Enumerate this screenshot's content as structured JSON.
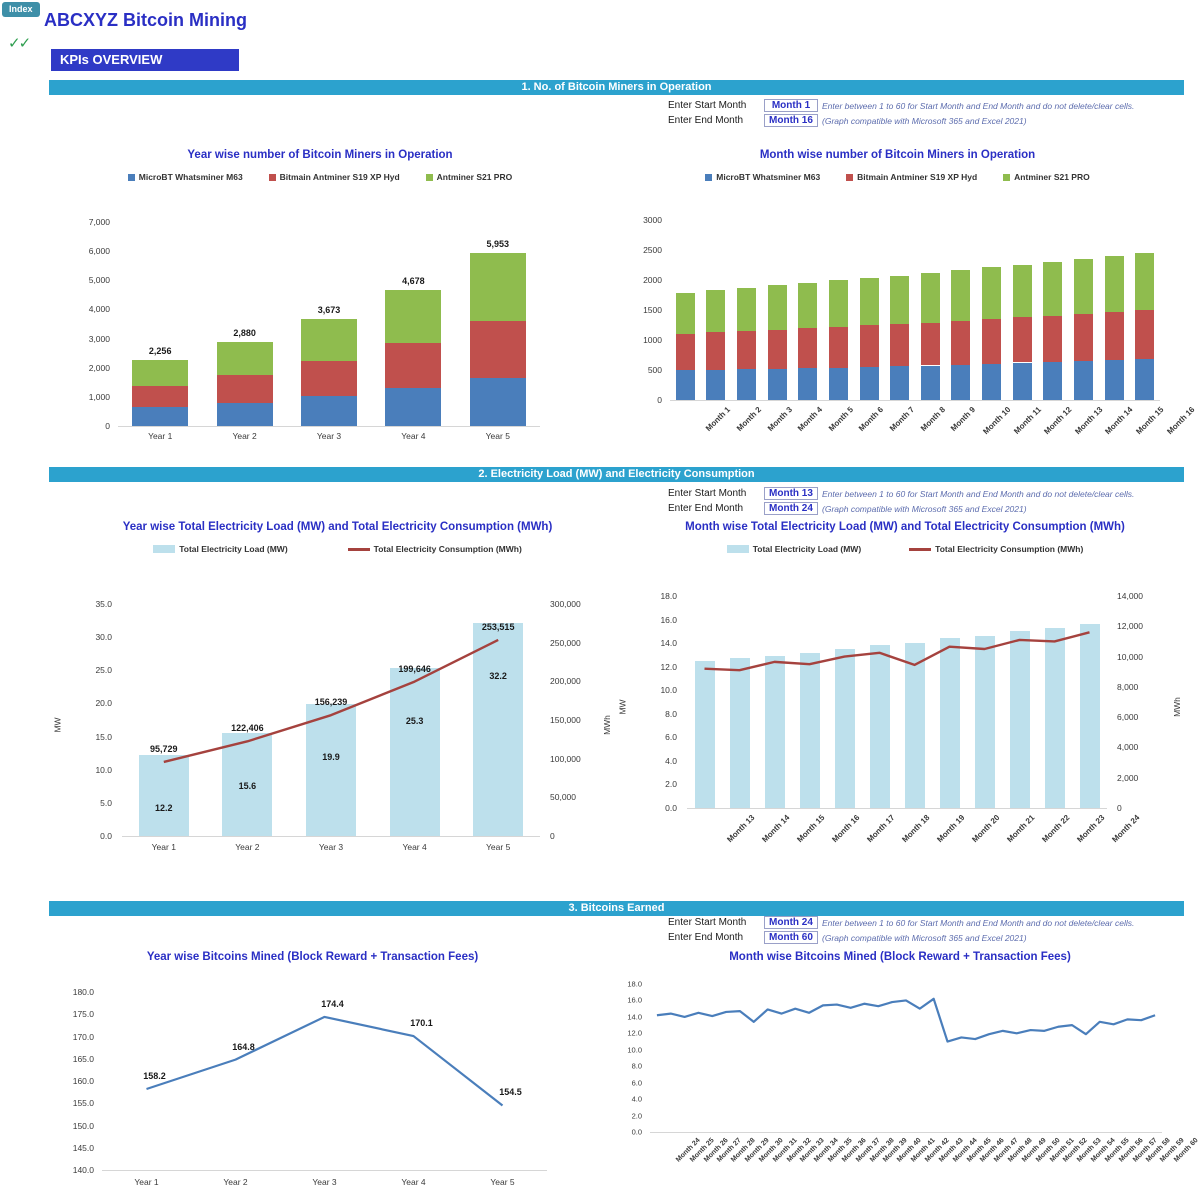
{
  "header": {
    "index_button": "Index",
    "checkmarks": "✓✓",
    "app_title": "ABCXYZ Bitcoin Mining",
    "kpi_tag": "KPIs OVERVIEW",
    "accent_teal": "#2CA2CE",
    "accent_blue": "#2F3AC6",
    "title_blue": "#2A2FC4"
  },
  "sections": [
    {
      "id": "sec1",
      "bar_title": "1. No. of Bitcoin Miners in Operation",
      "inputs": {
        "start_label": "Enter Start Month",
        "start_value": "Month 1",
        "end_label": "Enter End Month",
        "end_value": "Month 16",
        "note1": "Enter between 1 to 60 for Start Month and End Month and do not delete/clear cells.",
        "note2": "(Graph compatible with Microsoft 365 and Excel 2021)"
      }
    },
    {
      "id": "sec2",
      "bar_title": "2. Electricity Load (MW) and Electricity Consumption",
      "inputs": {
        "start_label": "Enter Start Month",
        "start_value": "Month 13",
        "end_label": "Enter End Month",
        "end_value": "Month 24",
        "note1": "Enter between 1 to 60 for Start Month and End Month and do not delete/clear cells.",
        "note2": "(Graph compatible with Microsoft 365 and Excel 2021)"
      }
    },
    {
      "id": "sec3",
      "bar_title": "3. Bitcoins Earned",
      "inputs": {
        "start_label": "Enter Start Month",
        "start_value": "Month 24",
        "end_label": "Enter End Month",
        "end_value": "Month 60",
        "note1": "Enter between 1 to 60 for Start Month and End Month and do not delete/clear cells.",
        "note2": "(Graph compatible with Microsoft 365 and Excel 2021)"
      }
    }
  ],
  "chart_data": [
    {
      "id": "year_miners",
      "type": "bar",
      "stacked": true,
      "title": "Year wise number of Bitcoin Miners in Operation",
      "xlabel": "",
      "ylabel": "",
      "ylim": [
        0,
        7000
      ],
      "yticks": [
        0,
        1000,
        2000,
        3000,
        4000,
        5000,
        6000,
        7000
      ],
      "ytick_labels": [
        "0",
        "1,000",
        "2,000",
        "3,000",
        "4,000",
        "5,000",
        "6,000",
        "7,000"
      ],
      "grid": false,
      "legend_position": "top",
      "categories": [
        "Year 1",
        "Year 2",
        "Year 3",
        "Year 4",
        "Year 5"
      ],
      "series": [
        {
          "name": "MicroBT Whatsminer M63",
          "color": "#4A7EBB",
          "values": [
            640,
            800,
            1020,
            1300,
            1630
          ]
        },
        {
          "name": "Bitmain Antminer S19 XP Hyd",
          "color": "#C0504D",
          "values": [
            740,
            950,
            1210,
            1540,
            1960
          ]
        },
        {
          "name": "Antminer S21 PRO",
          "color": "#8FBC4E",
          "values": [
            876,
            1130,
            1443,
            1838,
            2363
          ]
        }
      ],
      "totals": [
        2256,
        2880,
        3673,
        4678,
        5953
      ],
      "total_labels": [
        "2,256",
        "2,880",
        "3,673",
        "4,678",
        "5,953"
      ]
    },
    {
      "id": "month_miners",
      "type": "bar",
      "stacked": true,
      "title": "Month wise number of Bitcoin Miners in Operation",
      "xlabel": "",
      "ylabel": "",
      "ylim": [
        0,
        3000
      ],
      "yticks": [
        0,
        500,
        1000,
        1500,
        2000,
        2500,
        3000
      ],
      "ytick_labels": [
        "0",
        "500",
        "1000",
        "1500",
        "2000",
        "2500",
        "3000"
      ],
      "grid": false,
      "legend_position": "top",
      "categories": [
        "Month 1",
        "Month 2",
        "Month 3",
        "Month 4",
        "Month 5",
        "Month 6",
        "Month 7",
        "Month 8",
        "Month 9",
        "Month 10",
        "Month 11",
        "Month 12",
        "Month 13",
        "Month 14",
        "Month 15",
        "Month 16"
      ],
      "series": [
        {
          "name": "MicroBT Whatsminer M63",
          "color": "#4A7EBB",
          "values": [
            495,
            500,
            510,
            515,
            530,
            540,
            550,
            570,
            575,
            585,
            600,
            625,
            635,
            650,
            660,
            680
          ]
        },
        {
          "name": "Bitmain Antminer S19 XP Hyd",
          "color": "#C0504D",
          "values": [
            605,
            630,
            640,
            655,
            670,
            680,
            695,
            700,
            715,
            735,
            750,
            755,
            770,
            785,
            805,
            815
          ]
        },
        {
          "name": "Antminer S21 PRO",
          "color": "#8FBC4E",
          "values": [
            690,
            700,
            720,
            740,
            755,
            775,
            790,
            805,
            830,
            840,
            870,
            870,
            890,
            915,
            930,
            950
          ]
        }
      ],
      "totals": [
        1790,
        1830,
        1870,
        1910,
        1955,
        1995,
        2035,
        2075,
        2120,
        2160,
        2220,
        2250,
        2295,
        2350,
        2395,
        2445
      ]
    },
    {
      "id": "year_electricity",
      "type": "bar_line_combo",
      "title": "Year wise Total Electricity Load (MW) and Total Electricity Consumption (MWh)",
      "xlabel": "",
      "ylabel": "MW",
      "y2label": "MWh",
      "ylim": [
        0,
        35
      ],
      "yticks": [
        0,
        5,
        10,
        15,
        20,
        25,
        30,
        35
      ],
      "ytick_labels": [
        "0.0",
        "5.0",
        "10.0",
        "15.0",
        "20.0",
        "25.0",
        "30.0",
        "35.0"
      ],
      "y2lim": [
        0,
        300000
      ],
      "y2ticks": [
        0,
        50000,
        100000,
        150000,
        200000,
        250000,
        300000
      ],
      "y2tick_labels": [
        "0",
        "50,000",
        "100,000",
        "150,000",
        "200,000",
        "250,000",
        "300,000"
      ],
      "grid": false,
      "legend_position": "top",
      "categories": [
        "Year 1",
        "Year 2",
        "Year 3",
        "Year 4",
        "Year 5"
      ],
      "series": [
        {
          "name": "Total Electricity Load (MW)",
          "type": "bar",
          "color": "#BDE0EC",
          "axis": "left",
          "values": [
            12.2,
            15.6,
            19.9,
            25.3,
            32.2
          ],
          "labels": [
            "12.2",
            "15.6",
            "19.9",
            "25.3",
            "32.2"
          ]
        },
        {
          "name": "Total Electricity Consumption (MWh)",
          "type": "line",
          "color": "#A5423E",
          "axis": "right",
          "values": [
            95729,
            122406,
            156239,
            199646,
            253515
          ],
          "labels": [
            "95,729",
            "122,406",
            "156,239",
            "199,646",
            "253,515"
          ]
        }
      ]
    },
    {
      "id": "month_electricity",
      "type": "bar_line_combo",
      "title": "Month wise Total Electricity Load (MW) and Total Electricity Consumption (MWh)",
      "xlabel": "",
      "ylabel": "MW",
      "y2label": "MWh",
      "ylim": [
        0,
        18
      ],
      "yticks": [
        0,
        2,
        4,
        6,
        8,
        10,
        12,
        14,
        16,
        18
      ],
      "ytick_labels": [
        "0.0",
        "2.0",
        "4.0",
        "6.0",
        "8.0",
        "10.0",
        "12.0",
        "14.0",
        "16.0",
        "18.0"
      ],
      "y2lim": [
        0,
        14000
      ],
      "y2ticks": [
        0,
        2000,
        4000,
        6000,
        8000,
        10000,
        12000,
        14000
      ],
      "y2tick_labels": [
        "0",
        "2,000",
        "4,000",
        "6,000",
        "8,000",
        "10,000",
        "12,000",
        "14,000"
      ],
      "grid": false,
      "legend_position": "top",
      "categories": [
        "Month 13",
        "Month 14",
        "Month 15",
        "Month 16",
        "Month 17",
        "Month 18",
        "Month 19",
        "Month 20",
        "Month 21",
        "Month 22",
        "Month 23",
        "Month 24"
      ],
      "series": [
        {
          "name": "Total Electricity Load (MW)",
          "type": "bar",
          "color": "#BDE0EC",
          "axis": "left",
          "values": [
            12.5,
            12.7,
            12.9,
            13.2,
            13.5,
            13.8,
            14.0,
            14.4,
            14.6,
            15.0,
            15.3,
            15.6
          ]
        },
        {
          "name": "Total Electricity Consumption (MWh)",
          "type": "line",
          "color": "#A5423E",
          "axis": "right",
          "values": [
            9200,
            9100,
            9650,
            9500,
            10000,
            10250,
            9450,
            10650,
            10500,
            11100,
            11000,
            11600
          ]
        }
      ]
    },
    {
      "id": "year_bitcoins",
      "type": "line",
      "title": "Year wise Bitcoins Mined (Block Reward + Transaction Fees)",
      "xlabel": "",
      "ylabel": "",
      "ylim": [
        140,
        180
      ],
      "yticks": [
        140,
        145,
        150,
        155,
        160,
        165,
        170,
        175,
        180
      ],
      "ytick_labels": [
        "140.0",
        "145.0",
        "150.0",
        "155.0",
        "160.0",
        "165.0",
        "170.0",
        "175.0",
        "180.0"
      ],
      "grid": false,
      "legend_position": "none",
      "categories": [
        "Year 1",
        "Year 2",
        "Year 3",
        "Year 4",
        "Year 5"
      ],
      "series": [
        {
          "name": "Bitcoins Mined",
          "color": "#4A7EBB",
          "values": [
            158.2,
            164.8,
            174.4,
            170.1,
            154.5
          ],
          "labels": [
            "158.2",
            "164.8",
            "174.4",
            "170.1",
            "154.5"
          ]
        }
      ]
    },
    {
      "id": "month_bitcoins",
      "type": "line",
      "title": "Month wise Bitcoins Mined (Block Reward + Transaction Fees)",
      "xlabel": "",
      "ylabel": "",
      "ylim": [
        0,
        18
      ],
      "yticks": [
        0,
        2,
        4,
        6,
        8,
        10,
        12,
        14,
        16,
        18
      ],
      "ytick_labels": [
        "0.0",
        "2.0",
        "4.0",
        "6.0",
        "8.0",
        "10.0",
        "12.0",
        "14.0",
        "16.0",
        "18.0"
      ],
      "grid": false,
      "legend_position": "none",
      "categories": [
        "Month 24",
        "Month 25",
        "Month 26",
        "Month 27",
        "Month 28",
        "Month 29",
        "Month 30",
        "Month 31",
        "Month 32",
        "Month 33",
        "Month 34",
        "Month 35",
        "Month 36",
        "Month 37",
        "Month 38",
        "Month 39",
        "Month 40",
        "Month 41",
        "Month 42",
        "Month 43",
        "Month 44",
        "Month 45",
        "Month 46",
        "Month 47",
        "Month 48",
        "Month 49",
        "Month 50",
        "Month 51",
        "Month 52",
        "Month 53",
        "Month 54",
        "Month 55",
        "Month 56",
        "Month 57",
        "Month 58",
        "Month 59",
        "Month 60"
      ],
      "series": [
        {
          "name": "Bitcoins Mined",
          "color": "#4A7EBB",
          "values": [
            14.2,
            14.4,
            14.0,
            14.5,
            14.1,
            14.6,
            14.7,
            13.4,
            14.9,
            14.4,
            15.0,
            14.5,
            15.4,
            15.5,
            15.1,
            15.6,
            15.3,
            15.8,
            16.0,
            15.0,
            16.2,
            11.0,
            11.5,
            11.3,
            11.9,
            12.3,
            12.0,
            12.4,
            12.3,
            12.8,
            13.0,
            11.9,
            13.4,
            13.1,
            13.7,
            13.6,
            14.2
          ]
        }
      ]
    }
  ]
}
